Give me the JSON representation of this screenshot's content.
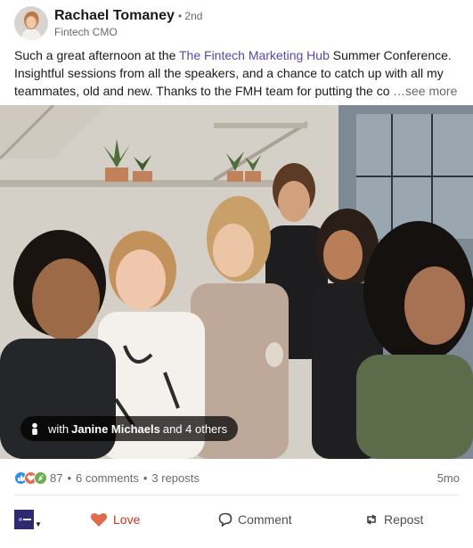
{
  "author": {
    "name": "Rachael Tomaney",
    "degree": "• 2nd",
    "title": "Fintech CMO"
  },
  "post": {
    "line1_before": "Such a great afternoon at the ",
    "mention": "The Fintech Marketing Hub",
    "line1_after": " Summer Conference.",
    "line2": "Insightful sessions from all the speakers, and a chance to catch up with all my",
    "line3": "teammates, old and new. Thanks to the FMH team for putting the co",
    "see_more": "…see more"
  },
  "photo_tag": {
    "prefix": "with",
    "person": "Janine Michaels",
    "suffix": "and 4 others"
  },
  "social": {
    "reactions_count": "87",
    "comments": "6 comments",
    "reposts": "3 reposts",
    "separator": "•",
    "age": "5mo"
  },
  "actions": {
    "love_label": "Love",
    "comment_label": "Comment",
    "repost_label": "Repost"
  },
  "colors": {
    "mention": "#5b45b3",
    "love": "#c0392b",
    "like": "#378fe9",
    "celebrate": "#6dae4f"
  }
}
